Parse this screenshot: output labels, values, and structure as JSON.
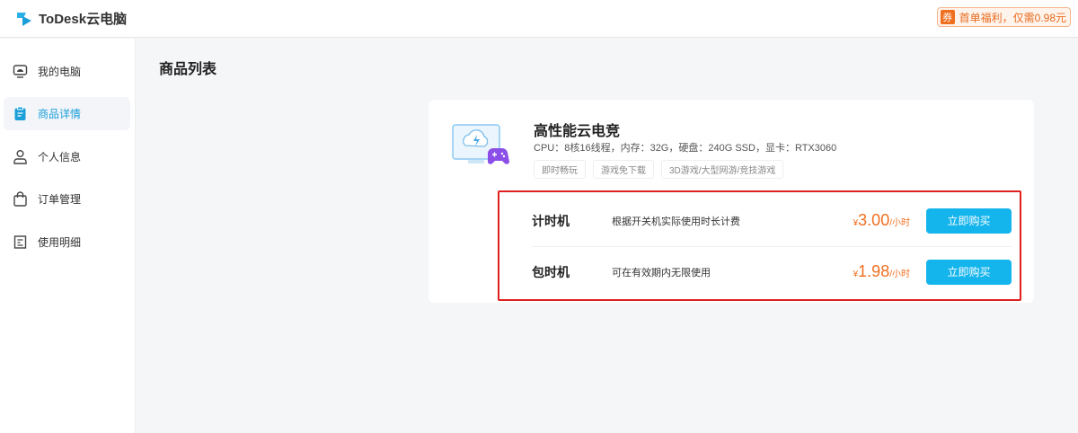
{
  "app": {
    "name": "ToDesk云电脑",
    "promo_badge": "券",
    "promo_text": "首单福利，仅需0.98元"
  },
  "sidebar": {
    "items": [
      {
        "label": "我的电脑"
      },
      {
        "label": "商品详情"
      },
      {
        "label": "个人信息"
      },
      {
        "label": "订单管理"
      },
      {
        "label": "使用明细"
      }
    ]
  },
  "main": {
    "title": "商品列表"
  },
  "product": {
    "name": "高性能云电竞",
    "spec": "CPU：8核16线程，内存：32G，硬盘：240G SSD，显卡：RTX3060",
    "tags": [
      "即时畅玩",
      "游戏免下载",
      "3D游戏/大型网游/竞技游戏"
    ],
    "plans": [
      {
        "name": "计时机",
        "desc": "根据开关机实际使用时长计费",
        "currency": "¥",
        "price": "3.00",
        "unit": "/小时",
        "button": "立即购买"
      },
      {
        "name": "包时机",
        "desc": "可在有效期内无限使用",
        "currency": "¥",
        "price": "1.98",
        "unit": "/小时",
        "button": "立即购买"
      }
    ]
  },
  "colors": {
    "accent": "#14b4ec",
    "price": "#f06f1f",
    "highlight": "#e02020"
  }
}
